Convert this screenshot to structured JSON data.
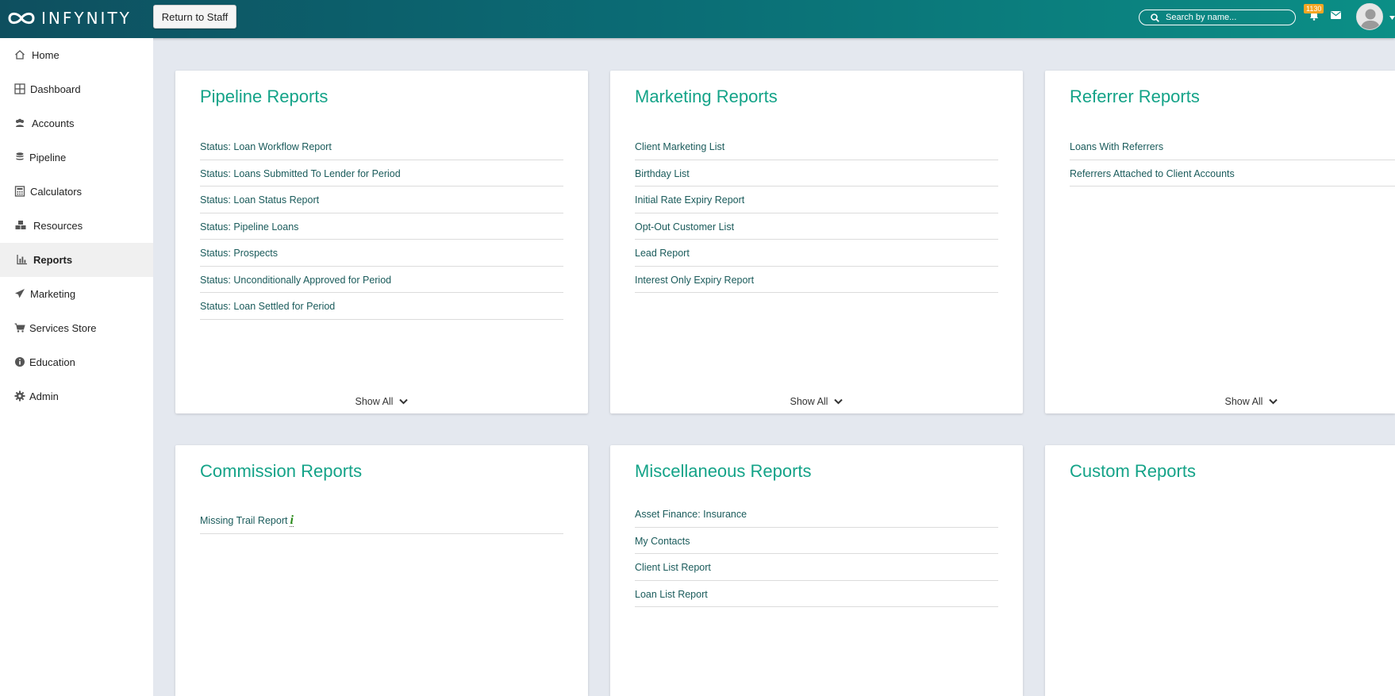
{
  "brand": {
    "name": "INFYNITY"
  },
  "topbar": {
    "return_button": "Return to Staff",
    "search_placeholder": "Search by name...",
    "notification_count": "1130"
  },
  "sidebar": {
    "items": [
      {
        "label": "Home",
        "icon": "home-icon"
      },
      {
        "label": "Dashboard",
        "icon": "dashboard-icon"
      },
      {
        "label": "Accounts",
        "icon": "users-icon"
      },
      {
        "label": "Pipeline",
        "icon": "database-icon"
      },
      {
        "label": "Calculators",
        "icon": "calculator-icon"
      },
      {
        "label": "Resources",
        "icon": "cubes-icon"
      },
      {
        "label": "Reports",
        "icon": "bar-chart-icon",
        "active": true
      },
      {
        "label": "Marketing",
        "icon": "paper-plane-icon"
      },
      {
        "label": "Services Store",
        "icon": "cart-icon"
      },
      {
        "label": "Education",
        "icon": "info-circle-icon"
      },
      {
        "label": "Admin",
        "icon": "gear-icon"
      }
    ]
  },
  "cards": {
    "pipeline": {
      "title": "Pipeline Reports",
      "links": [
        "Status: Loan Workflow Report",
        "Status: Loans Submitted To Lender for Period",
        "Status: Loan Status Report",
        "Status: Pipeline Loans",
        "Status: Prospects",
        "Status: Unconditionally Approved for Period",
        "Status: Loan Settled for Period"
      ],
      "show_all": "Show All"
    },
    "marketing": {
      "title": "Marketing Reports",
      "links": [
        "Client Marketing List",
        "Birthday List",
        "Initial Rate Expiry Report",
        "Opt-Out Customer List",
        "Lead Report",
        "Interest Only Expiry Report"
      ],
      "show_all": "Show All"
    },
    "referrer": {
      "title": "Referrer Reports",
      "links": [
        "Loans With Referrers",
        "Referrers Attached to Client Accounts"
      ],
      "show_all": "Show All"
    },
    "commission": {
      "title": "Commission Reports",
      "links": [
        "Missing Trail Report"
      ],
      "info_glyph": "i"
    },
    "misc": {
      "title": "Miscellaneous Reports",
      "links": [
        "Asset Finance: Insurance",
        "My Contacts",
        "Client List Report",
        "Loan List Report"
      ]
    },
    "custom": {
      "title": "Custom Reports"
    }
  },
  "colors": {
    "accent": "#14a388",
    "link": "#1a5b5b",
    "topbar_start": "#0e4f5f",
    "topbar_end": "#0b8f86",
    "badge": "#f5a623"
  }
}
